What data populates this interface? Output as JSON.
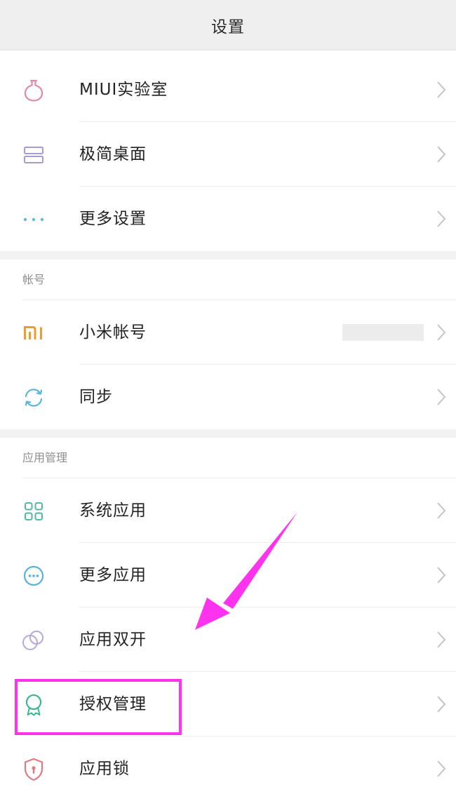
{
  "header": {
    "title": "设置"
  },
  "top_items": [
    {
      "label": "MIUI实验室",
      "icon": "flask-icon"
    },
    {
      "label": "极简桌面",
      "icon": "layout-icon"
    },
    {
      "label": "更多设置",
      "icon": "more-dots-icon"
    }
  ],
  "account_section": {
    "header": "帐号",
    "items": [
      {
        "label": "小米帐号",
        "icon": "mi-logo-icon"
      },
      {
        "label": "同步",
        "icon": "sync-icon"
      }
    ]
  },
  "apps_section": {
    "header": "应用管理",
    "items": [
      {
        "label": "系统应用",
        "icon": "grid-icon"
      },
      {
        "label": "更多应用",
        "icon": "chat-dots-icon"
      },
      {
        "label": "应用双开",
        "icon": "dual-circles-icon"
      },
      {
        "label": "授权管理",
        "icon": "badge-icon"
      },
      {
        "label": "应用锁",
        "icon": "shield-lock-icon"
      }
    ]
  },
  "colors": {
    "flask": "#e28aa5",
    "layout": "#a99ad6",
    "more_dots": "#68b6d6",
    "mi_logo": "#f39a2c",
    "sync": "#5eb4de",
    "grid": "#4fba9c",
    "chat_dots": "#5ab2d8",
    "dual_circles": "#b9a7dd",
    "badge": "#3fb58a",
    "shield_lock": "#e07a85",
    "annotation": "#ff33ee"
  }
}
